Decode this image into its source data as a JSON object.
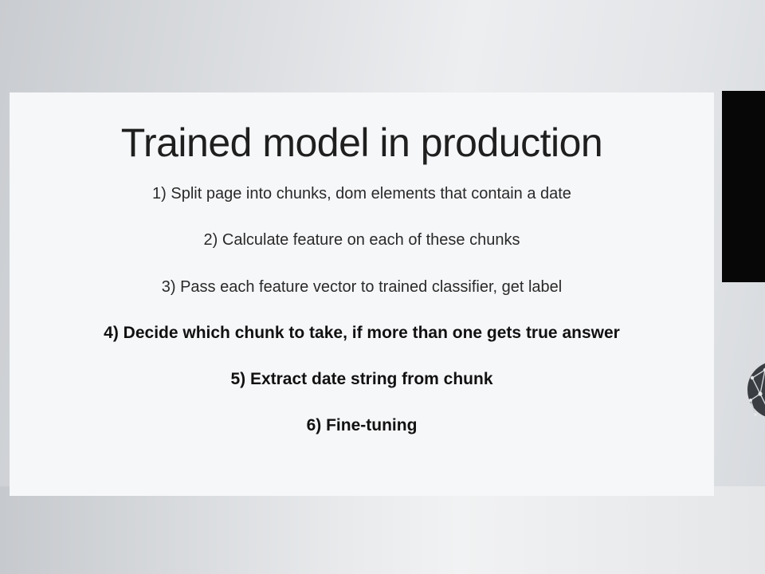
{
  "slide": {
    "title": "Trained model in production",
    "steps": [
      "1) Split page into chunks, dom elements that contain a date",
      "2) Calculate feature on each of these chunks",
      "3) Pass each feature vector to trained classifier, get label",
      "4) Decide which chunk to take, if more than one gets true answer",
      "5) Extract date string from chunk",
      "6) Fine-tuning"
    ]
  },
  "colors": {
    "slide_background": "#f6f7f9",
    "text": "#2a2a2a",
    "side_panel": "#070707",
    "badge": "#3a3d42"
  },
  "icons": {
    "badge": "network-logo-icon"
  }
}
